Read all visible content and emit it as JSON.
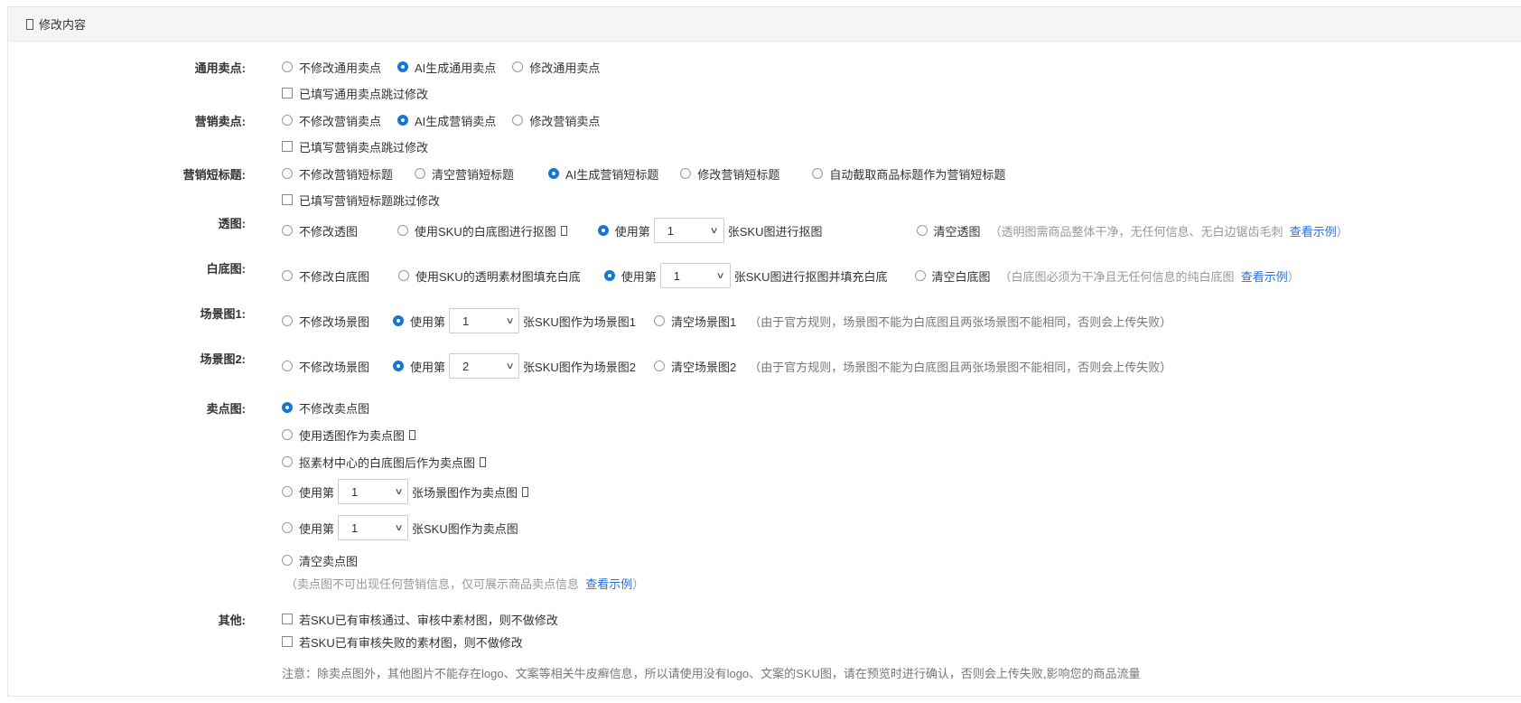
{
  "header": {
    "title": "修改内容"
  },
  "general": {
    "label": "通用卖点:",
    "options": [
      "不修改通用卖点",
      "AI生成通用卖点",
      "修改通用卖点"
    ],
    "skip": "已填写通用卖点跳过修改"
  },
  "marketing": {
    "label": "营销卖点:",
    "options": [
      "不修改营销卖点",
      "AI生成营销卖点",
      "修改营销卖点"
    ],
    "skip": "已填写营销卖点跳过修改"
  },
  "short_title": {
    "label": "营销短标题:",
    "options": [
      "不修改营销短标题",
      "清空营销短标题",
      "AI生成营销短标题",
      "修改营销短标题",
      "自动截取商品标题作为营销短标题"
    ],
    "skip": "已填写营销短标题跳过修改"
  },
  "transparent": {
    "label": "透图:",
    "opt1": "不修改透图",
    "opt2": "使用SKU的白底图进行抠图",
    "use_prefix": "使用第",
    "select_value": "1",
    "use_suffix": "张SKU图进行抠图",
    "clear": "清空透图",
    "hint_open": "（透明图需商品整体干净，无任何信息、无白边锯齿毛刺",
    "link": "查看示例",
    "hint_close": "）"
  },
  "white": {
    "label": "白底图:",
    "opt1": "不修改白底图",
    "opt2": "使用SKU的透明素材图填充白底",
    "use_prefix": "使用第",
    "select_value": "1",
    "use_suffix": "张SKU图进行抠图并填充白底",
    "clear": "清空白底图",
    "hint_open": "（白底图必须为干净且无任何信息的纯白底图",
    "link": "查看示例",
    "hint_close": "）"
  },
  "scene1": {
    "label": "场景图1:",
    "opt1": "不修改场景图",
    "use_prefix": "使用第",
    "select_value": "1",
    "use_suffix": "张SKU图作为场景图1",
    "clear": "清空场景图1",
    "hint": "（由于官方规则，场景图不能为白底图且两张场景图不能相同，否则会上传失败）"
  },
  "scene2": {
    "label": "场景图2:",
    "opt1": "不修改场景图",
    "use_prefix": "使用第",
    "select_value": "2",
    "use_suffix": "张SKU图作为场景图2",
    "clear": "清空场景图2",
    "hint": "（由于官方规则，场景图不能为白底图且两张场景图不能相同，否则会上传失败）"
  },
  "selling": {
    "label": "卖点图:",
    "opt1": "不修改卖点图",
    "opt2": "使用透图作为卖点图",
    "opt3": "抠素材中心的白底图后作为卖点图",
    "opt4_prefix": "使用第",
    "opt4_value": "1",
    "opt4_suffix": "张场景图作为卖点图",
    "opt5_prefix": "使用第",
    "opt5_value": "1",
    "opt5_suffix": "张SKU图作为卖点图",
    "opt6": "清空卖点图",
    "hint_open": "（卖点图不可出现任何营销信息，仅可展示商品卖点信息",
    "link": "查看示例",
    "hint_close": "）"
  },
  "other": {
    "label": "其他:",
    "chk1": "若SKU已有审核通过、审核中素材图，则不做修改",
    "chk2": "若SKU已有审核失败的素材图，则不做修改"
  },
  "note": "注意：除卖点图外，其他图片不能存在logo、文案等相关牛皮癣信息，所以请使用没有logo、文案的SKU图，请在预览时进行确认，否则会上传失败,影响您的商品流量"
}
